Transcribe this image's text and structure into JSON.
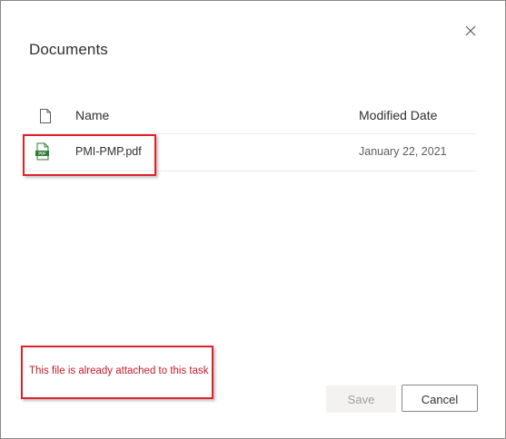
{
  "dialog": {
    "title": "Documents",
    "close_icon": "close-icon"
  },
  "table": {
    "header_icon": "document-icon",
    "columns": [
      "Name",
      "Modified Date"
    ],
    "rows": [
      {
        "icon": "pdf-file-icon",
        "name": "PMI-PMP.pdf",
        "modified": "January 22, 2021"
      }
    ]
  },
  "message": "This file is already attached to this task",
  "buttons": {
    "save": "Save",
    "cancel": "Cancel"
  },
  "colors": {
    "annotation_red": "#e0202a",
    "message_red": "#c01c28",
    "pdf_green": "#2e7d32"
  }
}
